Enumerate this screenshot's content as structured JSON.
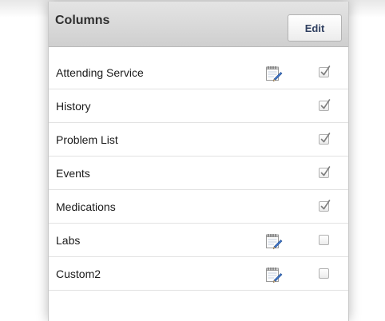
{
  "panel": {
    "title": "Columns",
    "edit_label": "Edit"
  },
  "columns": [
    {
      "label": "Attending Service",
      "has_edit_icon": true,
      "checked": true
    },
    {
      "label": "History",
      "has_edit_icon": false,
      "checked": true
    },
    {
      "label": "Problem List",
      "has_edit_icon": false,
      "checked": true
    },
    {
      "label": "Events",
      "has_edit_icon": false,
      "checked": true
    },
    {
      "label": "Medications",
      "has_edit_icon": false,
      "checked": true
    },
    {
      "label": "Labs",
      "has_edit_icon": true,
      "checked": false
    },
    {
      "label": "Custom2",
      "has_edit_icon": true,
      "checked": false
    }
  ],
  "icons": {
    "edit": "notepad-pencil-icon",
    "checkbox": "checkbox-icon"
  }
}
